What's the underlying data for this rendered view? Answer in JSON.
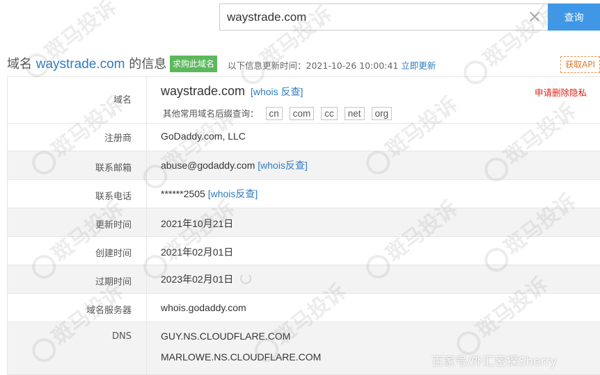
{
  "search": {
    "value": "waystrade.com",
    "button_label": "查询"
  },
  "header": {
    "prefix": "域名",
    "domain": "waystrade.com",
    "suffix": "的信息",
    "buy_badge": "求购此域名",
    "update_prefix": "以下信息更新时间：",
    "update_time": "2021-10-26 10:00:41",
    "update_link": "立即更新",
    "api_button": "获取API"
  },
  "rows": {
    "domain": {
      "label": "域名",
      "value": "waystrade.com",
      "whois_link": "[whois 反查]",
      "privacy_link": "申请删除隐私",
      "suffix_prompt": "其他常用域名后缀查询：",
      "suffixes": [
        "cn",
        "com",
        "cc",
        "net",
        "org"
      ]
    },
    "registrar": {
      "label": "注册商",
      "value": "GoDaddy.com, LLC"
    },
    "email": {
      "label": "联系邮箱",
      "value": "abuse@godaddy.com",
      "whois_link": "[whois反查]"
    },
    "phone": {
      "label": "联系电话",
      "value": "******2505",
      "whois_link": "[whois反查]"
    },
    "updated": {
      "label": "更新时间",
      "value": "2021年10月21日"
    },
    "created": {
      "label": "创建时间",
      "value": "2021年02月01日"
    },
    "expires": {
      "label": "过期时间",
      "value": "2023年02月01日"
    },
    "whois_server": {
      "label": "域名服务器",
      "value": "whois.godaddy.com"
    },
    "dns": {
      "label": "DNS",
      "values": [
        "GUY.NS.CLOUDFLARE.COM",
        "MARLOWE.NS.CLOUDFLARE.COM"
      ]
    }
  },
  "watermark": {
    "text": "斑马投诉"
  },
  "source_mark": "百家号/外汇密探Sherry",
  "colors": {
    "accent": "#3f97e5",
    "link": "#2f7cc2",
    "badge": "#5cb85c",
    "privacy": "#d9241b",
    "api": "#e07a2e"
  }
}
